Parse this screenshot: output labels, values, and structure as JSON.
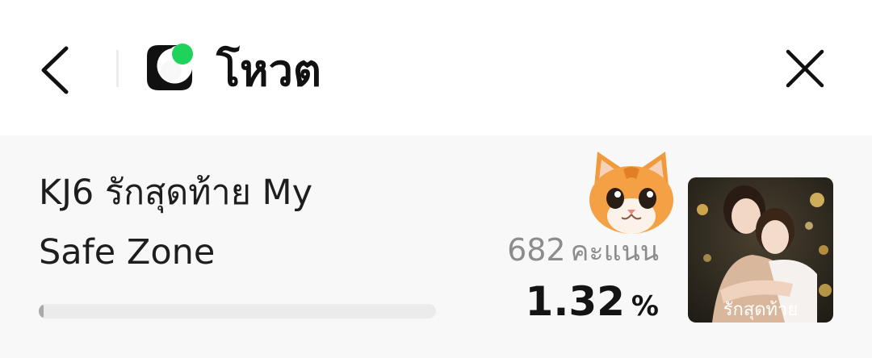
{
  "header": {
    "title": "โหวต",
    "back_icon": "chevron-left-icon",
    "close_icon": "close-icon",
    "logo_icon": "vote-logo-icon",
    "logo_accent_color": "#1fd35a"
  },
  "item": {
    "title": "KJ6 รักสุดท้าย My Safe Zone",
    "votes": "682",
    "votes_unit": "คะแนน",
    "percent": "1.32",
    "percent_sign": "%",
    "progress_fraction": 0.0132,
    "mascot_icon": "cat-face-icon",
    "poster_caption": "รักสุดท้าย"
  }
}
